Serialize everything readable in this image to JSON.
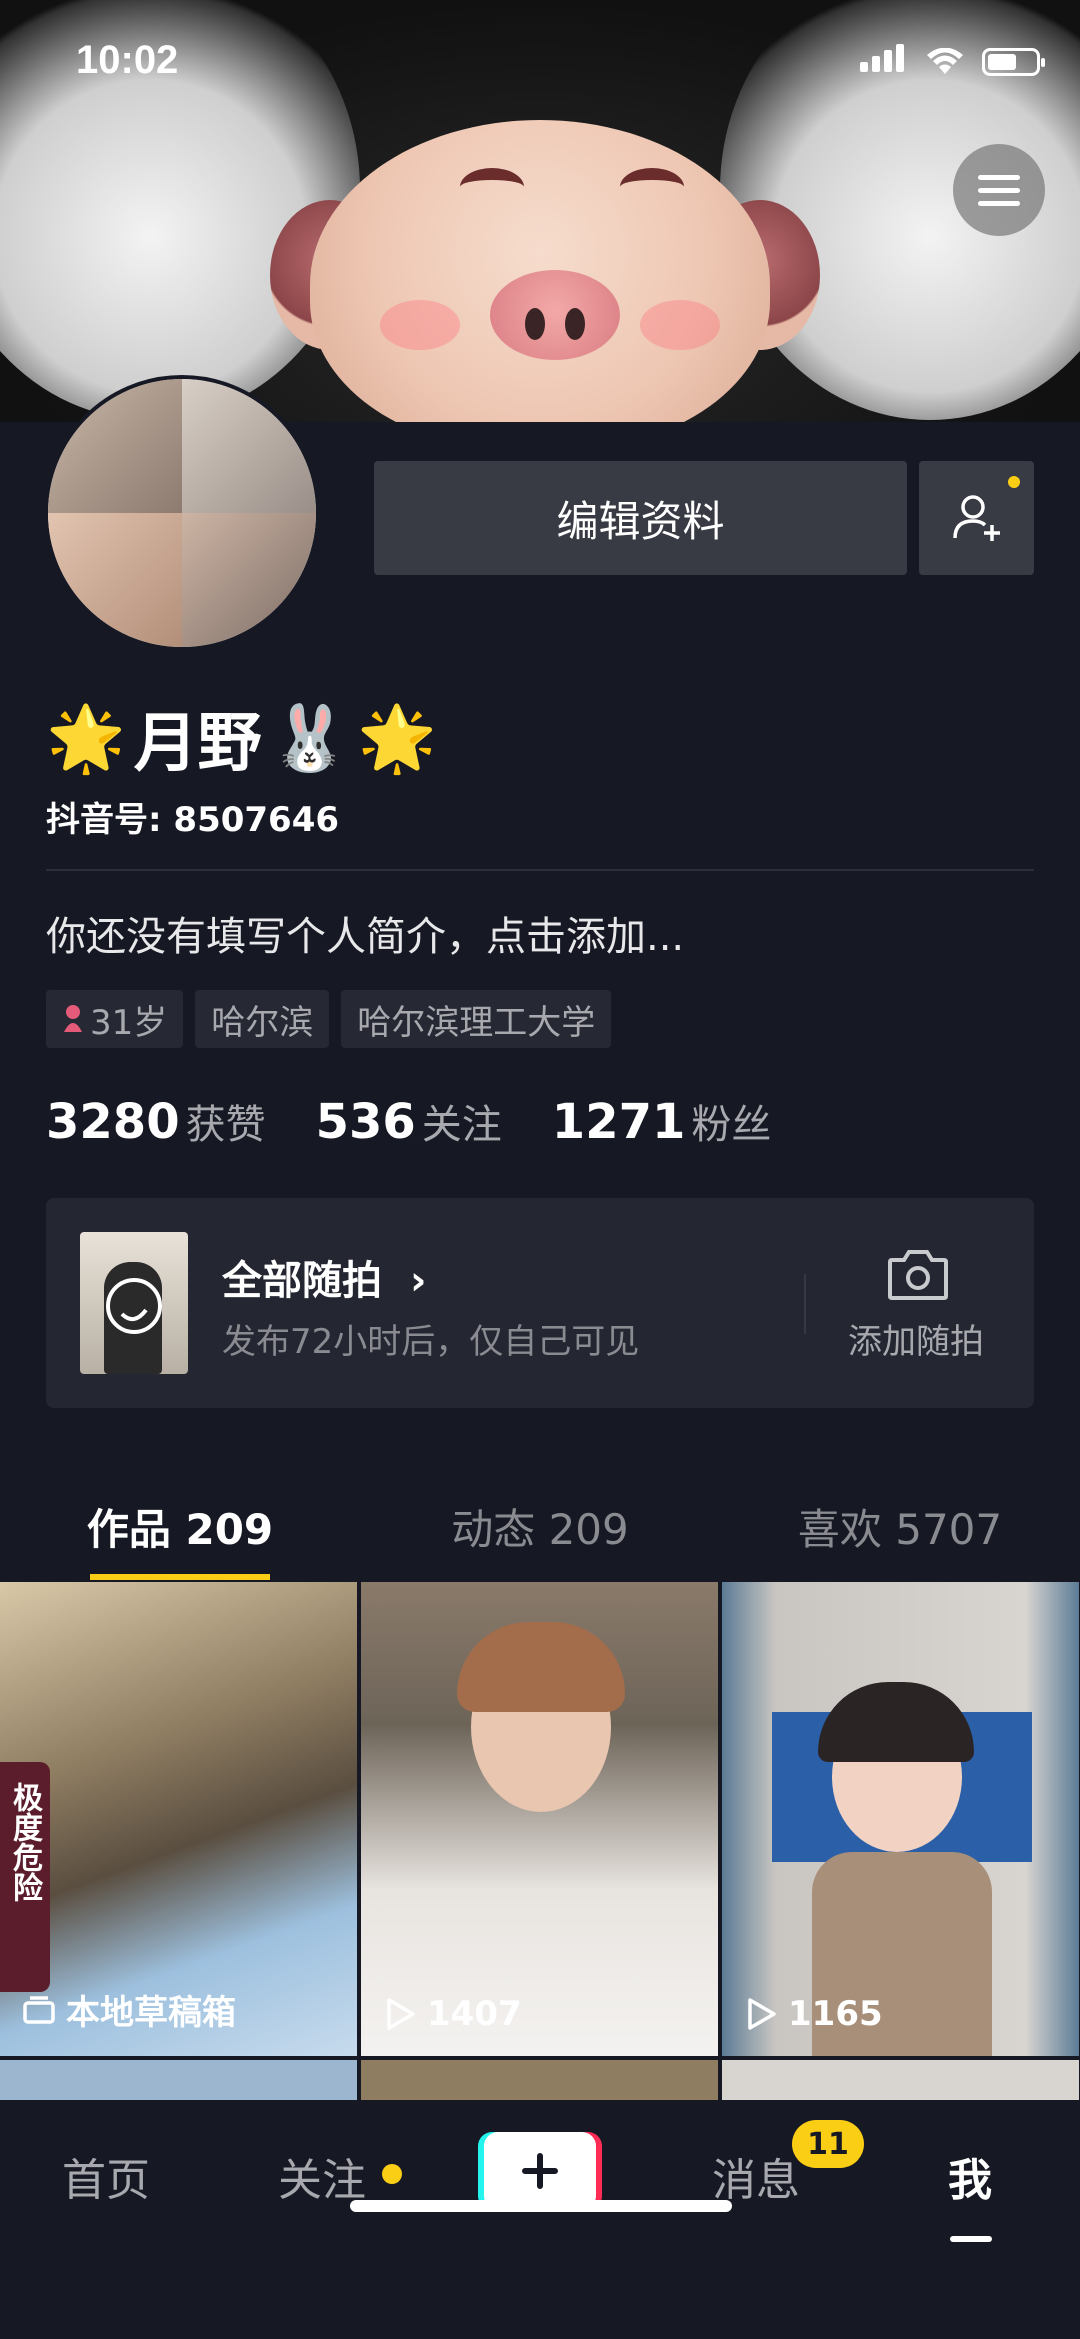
{
  "status_bar": {
    "time": "10:02"
  },
  "profile": {
    "edit_label": "编辑资料",
    "nickname": "月野",
    "nickname_emojis": [
      "🌟",
      "🐰",
      "🌟"
    ],
    "douyin_id": "抖音号: 8507646",
    "bio_placeholder": "你还没有填写个人简介，点击添加...",
    "tags": [
      {
        "icon": "female-icon",
        "label": "31岁"
      },
      {
        "label": "哈尔滨"
      },
      {
        "label": "哈尔滨理工大学"
      }
    ],
    "stats": [
      {
        "value": "3280",
        "label": "获赞"
      },
      {
        "value": "536",
        "label": "关注"
      },
      {
        "value": "1271",
        "label": "粉丝"
      }
    ]
  },
  "story": {
    "title": "全部随拍",
    "subtitle": "发布72小时后，仅自己可见",
    "add_label": "添加随拍"
  },
  "tabs": [
    {
      "label": "作品 209",
      "active": true
    },
    {
      "label": "动态 209",
      "active": false
    },
    {
      "label": "喜欢 5707",
      "active": false
    }
  ],
  "grid": [
    {
      "label": "本地草稿箱",
      "icon": "draft-box-icon",
      "overlay_text": "极度危险"
    },
    {
      "label": "1407",
      "icon": "play-icon"
    },
    {
      "label": "1165",
      "icon": "play-icon"
    }
  ],
  "bottom_nav": {
    "items": [
      "首页",
      "关注",
      "消息",
      "我"
    ],
    "message_badge": "11",
    "active": "我"
  },
  "colors": {
    "background": "#161823",
    "accent": "#face15",
    "button": "#393b44"
  }
}
